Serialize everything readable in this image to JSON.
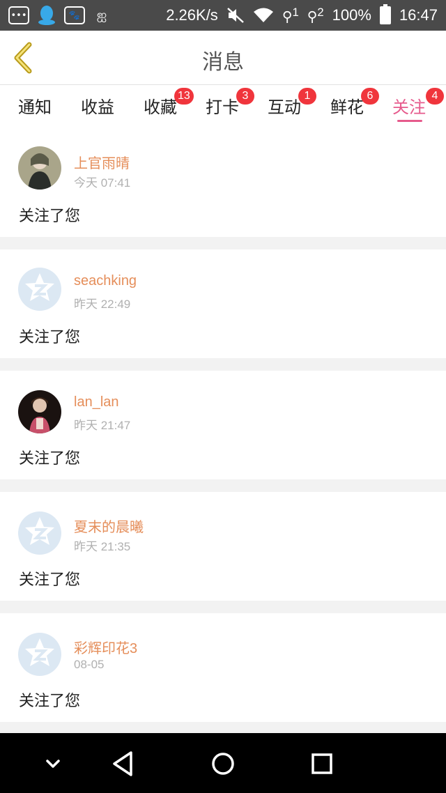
{
  "status_bar": {
    "net_speed": "2.26K/s",
    "sim1": "1",
    "sim2": "2",
    "battery": "100%",
    "clock": "16:47",
    "icons": [
      "chat-icon",
      "qq-icon",
      "baidu-paw-icon",
      "wechat-icon",
      "mute-icon",
      "wifi-icon",
      "signal-icon",
      "battery-icon"
    ]
  },
  "header": {
    "title": "消息",
    "back_icon": "chevron-left-icon"
  },
  "tabs": [
    {
      "label": "通知",
      "badge": ""
    },
    {
      "label": "收益",
      "badge": ""
    },
    {
      "label": "收藏",
      "badge": "13"
    },
    {
      "label": "打卡",
      "badge": "3"
    },
    {
      "label": "互动",
      "badge": "1"
    },
    {
      "label": "鲜花",
      "badge": "6"
    },
    {
      "label": "关注",
      "badge": "4"
    }
  ],
  "active_tab": "关注",
  "colors": {
    "accent": "#e65a8c",
    "username": "#e58e5a",
    "badge": "#f0353c"
  },
  "items": [
    {
      "name": "上官雨晴",
      "time": "今天 07:41",
      "message": "关注了您",
      "avatar": "photo"
    },
    {
      "name": "seachking",
      "time": "昨天 22:49",
      "message": "关注了您",
      "avatar": "default"
    },
    {
      "name": "lan_lan",
      "time": "昨天 21:47",
      "message": "关注了您",
      "avatar": "photo"
    },
    {
      "name": "夏末的晨曦",
      "time": "昨天 21:35",
      "message": "关注了您",
      "avatar": "default"
    },
    {
      "name": "彩辉印花3",
      "time": "08-05",
      "message": "关注了您",
      "avatar": "default"
    }
  ],
  "nav_bar": {
    "icons": [
      "chevron-down-icon",
      "back-triangle-icon",
      "home-circle-icon",
      "recents-square-icon"
    ]
  }
}
